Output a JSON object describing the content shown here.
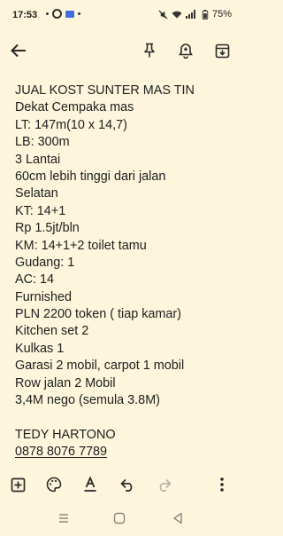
{
  "status_bar": {
    "time": "17:53",
    "battery": "75%",
    "icons": [
      "notification-dot-icon",
      "ring-notification-icon",
      "mail-icon",
      "more-dot-icon",
      "mute-icon",
      "wifi-icon",
      "signal-icon",
      "battery-icon"
    ]
  },
  "toolbar": {
    "icons": [
      "arrow-left-icon",
      "pin-icon",
      "reminder-bell-icon",
      "archive-icon"
    ]
  },
  "note": {
    "lines": [
      "JUAL KOST SUNTER MAS TIN",
      "Dekat Cempaka mas",
      "LT: 147m(10 x 14,7)",
      "LB: 300m",
      "3 Lantai",
      "60cm lebih tinggi dari jalan",
      "Selatan",
      "KT: 14+1",
      "Rp 1.5jt/bln",
      "KM: 14+1+2 toilet tamu",
      "Gudang: 1",
      "AC: 14",
      "Furnished",
      "PLN 2200 token ( tiap kamar)",
      "Kitchen set 2",
      "Kulkas 1",
      "Garasi 2 mobil, carpot 1 mobil",
      "Row jalan 2 Mobil",
      "3,4M nego (semula 3.8M)",
      "",
      "TEDY HARTONO",
      "0878 8076 7789"
    ]
  },
  "bottom_toolbar": {
    "icons": [
      "add-box-icon",
      "palette-icon",
      "text-format-icon",
      "undo-icon",
      "redo-icon",
      "more-vert-icon"
    ]
  },
  "nav_bar": {
    "icons": [
      "recent-apps-icon",
      "home-icon",
      "back-triangle-icon"
    ]
  },
  "colors": {
    "background": "#fdf6dc",
    "text": "#202020",
    "icon": "#3a3a3a",
    "disabled_icon": "#b8b5a8"
  }
}
